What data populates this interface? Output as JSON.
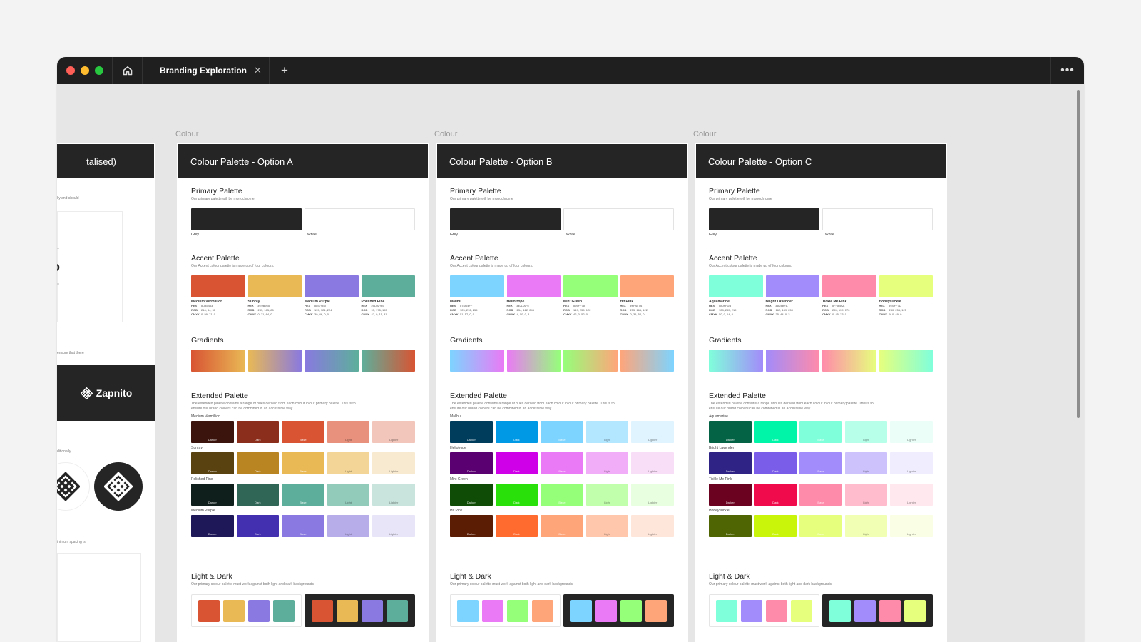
{
  "window": {
    "tab_title": "Branding Exploration",
    "tab_close": "✕",
    "new_tab": "+",
    "more": "•••",
    "home_icon": "home-icon",
    "traffic_lights": [
      "#ff5f57",
      "#febc2e",
      "#28c840"
    ]
  },
  "left_board": {
    "title": "talised)",
    "notes": [
      "lly and should",
      "ensure that there",
      "ditionally",
      "inimum spacing is"
    ],
    "logo_text": "Zapnito"
  },
  "common": {
    "frame_label": "Colour",
    "primary_title": "Primary Palette",
    "primary_sub": "Our primary palette will be monochrome",
    "grey_label": "Grey",
    "white_label": "White",
    "accent_title": "Accent Palette",
    "accent_sub": "Our Accent colour palette is made up of four colours.",
    "gradients_title": "Gradients",
    "extended_title": "Extended Palette",
    "extended_sub1": "The extended palette contains a range of hues derived from each colour in our primary palette. This is to",
    "extended_sub2": "ensure our brand colours can be combined in an accessible way",
    "shade_labels": [
      "Darker",
      "Dark",
      "Base",
      "Light",
      "Lighter"
    ],
    "light_dark_title": "Light & Dark",
    "light_dark_sub": "Our primary colour palette must work against both light and dark backgrounds.",
    "code_keys": [
      "HEX",
      "RGB",
      "CMYK"
    ]
  },
  "boards": [
    {
      "title": "Colour Palette - Option A",
      "accents": [
        {
          "name": "Medium Vermillion",
          "hex": "#D85433",
          "rgb": "216, 84, 51",
          "cmyk": "0, 59, 71, 0",
          "color": "#d85433"
        },
        {
          "name": "Sunray",
          "hex": "#E9B955",
          "rgb": "233, 185, 85",
          "cmyk": "0, 21, 64, 0",
          "color": "#e9b955"
        },
        {
          "name": "Medium Purple",
          "hex": "#8979E0",
          "rgb": "137, 121, 224",
          "cmyk": "39, 46, 0, 0",
          "color": "#8979e0"
        },
        {
          "name": "Polished Pine",
          "hex": "#5DAF9B",
          "rgb": "93, 175, 155",
          "cmyk": "47, 0, 11, 31",
          "color": "#5daf9b"
        }
      ],
      "gradients": [
        [
          "#d85433",
          "#e9b955"
        ],
        [
          "#e9b955",
          "#8979e0"
        ],
        [
          "#8979e0",
          "#5daf9b"
        ],
        [
          "#5daf9b",
          "#d85433"
        ]
      ],
      "extended": [
        {
          "name": "Medium Vermillion",
          "shades": [
            "#3b140d",
            "#8b2f1c",
            "#d85433",
            "#e8917d",
            "#f2c6bb"
          ]
        },
        {
          "name": "Sunray",
          "shades": [
            "#5a4210",
            "#b98523",
            "#e9b955",
            "#f2d597",
            "#f8ead0"
          ]
        },
        {
          "name": "Polished Pine",
          "shades": [
            "#0f1f1b",
            "#2f6656",
            "#5daf9b",
            "#93cbbb",
            "#c8e4dc"
          ]
        },
        {
          "name": "Medium Purple",
          "shades": [
            "#1e1858",
            "#4330b0",
            "#8979e0",
            "#b7aee9",
            "#e8e5f8"
          ]
        }
      ]
    },
    {
      "title": "Colour Palette - Option B",
      "accents": [
        {
          "name": "Malibu",
          "hex": "#7DD4FF",
          "rgb": "125, 212, 255",
          "cmyk": "51, 17, 0, 0",
          "color": "#7dd4ff"
        },
        {
          "name": "Heliotrope",
          "hex": "#EA7AF5",
          "rgb": "234, 122, 245",
          "cmyk": "4, 50, 0, 4",
          "color": "#ea7af5"
        },
        {
          "name": "Mint Green",
          "hex": "#95FF7A",
          "rgb": "149, 255, 122",
          "cmyk": "42, 0, 52, 0",
          "color": "#95ff7a"
        },
        {
          "name": "Hit Pink",
          "hex": "#FFA57A",
          "rgb": "255, 165, 122",
          "cmyk": "0, 35, 52, 0",
          "color": "#ffa57a"
        }
      ],
      "gradients": [
        [
          "#7dd4ff",
          "#ea7af5"
        ],
        [
          "#ea7af5",
          "#95ff7a"
        ],
        [
          "#95ff7a",
          "#ffa57a"
        ],
        [
          "#ffa57a",
          "#7dd4ff"
        ]
      ],
      "extended": [
        {
          "name": "Malibu",
          "shades": [
            "#003d5c",
            "#0099e6",
            "#7dd4ff",
            "#b3e6ff",
            "#e0f4ff"
          ]
        },
        {
          "name": "Heliotrope",
          "shades": [
            "#5a0070",
            "#cf00e8",
            "#ea7af5",
            "#f2adf8",
            "#f9def8"
          ]
        },
        {
          "name": "Mint Green",
          "shades": [
            "#0f4d06",
            "#2ae00a",
            "#95ff7a",
            "#c2ffad",
            "#e8ffe0"
          ]
        },
        {
          "name": "Hit Pink",
          "shades": [
            "#5c1d05",
            "#ff6a2e",
            "#ffa57a",
            "#ffc8ad",
            "#ffe6da"
          ]
        }
      ]
    },
    {
      "title": "Colour Palette - Option C",
      "accents": [
        {
          "name": "Aquamarine",
          "hex": "#80FFDB",
          "rgb": "128, 255, 219",
          "cmyk": "50, 0, 14, 0",
          "color": "#80ffdb"
        },
        {
          "name": "Bright Lavender",
          "hex": "#A28BFA",
          "rgb": "162, 139, 250",
          "cmyk": "35, 44, 0, 2",
          "color": "#a28bfa"
        },
        {
          "name": "Tickle Me Pink",
          "hex": "#FF8BAA",
          "rgb": "255, 139, 170",
          "cmyk": "0, 45, 33, 0",
          "color": "#ff8baa"
        },
        {
          "name": "Honeysuckle",
          "hex": "#E6FF7D",
          "rgb": "230, 255, 125",
          "cmyk": "9, 0, 49, 0",
          "color": "#e6ff7d"
        }
      ],
      "gradients": [
        [
          "#80ffdb",
          "#a28bfa"
        ],
        [
          "#a28bfa",
          "#ff8baa"
        ],
        [
          "#ff8baa",
          "#e6ff7d"
        ],
        [
          "#e6ff7d",
          "#80ffdb"
        ]
      ],
      "extended": [
        {
          "name": "Aquamarine",
          "shades": [
            "#056345",
            "#00f5a8",
            "#80ffdb",
            "#b8ffe9",
            "#ebfff8"
          ]
        },
        {
          "name": "Bright Lavender",
          "shades": [
            "#2f2385",
            "#7a5de8",
            "#a28bfa",
            "#cdc2fc",
            "#f0edfe"
          ]
        },
        {
          "name": "Tickle Me Pink",
          "shades": [
            "#6b0320",
            "#f00c4c",
            "#ff8baa",
            "#ffbccc",
            "#ffe8ee"
          ]
        },
        {
          "name": "Honeysuckle",
          "shades": [
            "#4f6403",
            "#c9f50a",
            "#e6ff7d",
            "#f0ffb3",
            "#fafee4"
          ]
        }
      ]
    }
  ]
}
